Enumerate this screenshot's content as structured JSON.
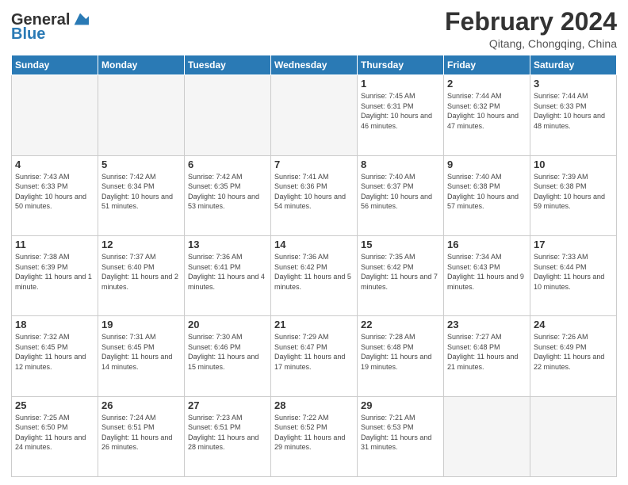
{
  "header": {
    "logo_line1": "General",
    "logo_line2": "Blue",
    "title": "February 2024",
    "subtitle": "Qitang, Chongqing, China"
  },
  "days_of_week": [
    "Sunday",
    "Monday",
    "Tuesday",
    "Wednesday",
    "Thursday",
    "Friday",
    "Saturday"
  ],
  "weeks": [
    [
      {
        "day": "",
        "info": ""
      },
      {
        "day": "",
        "info": ""
      },
      {
        "day": "",
        "info": ""
      },
      {
        "day": "",
        "info": ""
      },
      {
        "day": "1",
        "info": "Sunrise: 7:45 AM\nSunset: 6:31 PM\nDaylight: 10 hours\nand 46 minutes."
      },
      {
        "day": "2",
        "info": "Sunrise: 7:44 AM\nSunset: 6:32 PM\nDaylight: 10 hours\nand 47 minutes."
      },
      {
        "day": "3",
        "info": "Sunrise: 7:44 AM\nSunset: 6:33 PM\nDaylight: 10 hours\nand 48 minutes."
      }
    ],
    [
      {
        "day": "4",
        "info": "Sunrise: 7:43 AM\nSunset: 6:33 PM\nDaylight: 10 hours\nand 50 minutes."
      },
      {
        "day": "5",
        "info": "Sunrise: 7:42 AM\nSunset: 6:34 PM\nDaylight: 10 hours\nand 51 minutes."
      },
      {
        "day": "6",
        "info": "Sunrise: 7:42 AM\nSunset: 6:35 PM\nDaylight: 10 hours\nand 53 minutes."
      },
      {
        "day": "7",
        "info": "Sunrise: 7:41 AM\nSunset: 6:36 PM\nDaylight: 10 hours\nand 54 minutes."
      },
      {
        "day": "8",
        "info": "Sunrise: 7:40 AM\nSunset: 6:37 PM\nDaylight: 10 hours\nand 56 minutes."
      },
      {
        "day": "9",
        "info": "Sunrise: 7:40 AM\nSunset: 6:38 PM\nDaylight: 10 hours\nand 57 minutes."
      },
      {
        "day": "10",
        "info": "Sunrise: 7:39 AM\nSunset: 6:38 PM\nDaylight: 10 hours\nand 59 minutes."
      }
    ],
    [
      {
        "day": "11",
        "info": "Sunrise: 7:38 AM\nSunset: 6:39 PM\nDaylight: 11 hours\nand 1 minute."
      },
      {
        "day": "12",
        "info": "Sunrise: 7:37 AM\nSunset: 6:40 PM\nDaylight: 11 hours\nand 2 minutes."
      },
      {
        "day": "13",
        "info": "Sunrise: 7:36 AM\nSunset: 6:41 PM\nDaylight: 11 hours\nand 4 minutes."
      },
      {
        "day": "14",
        "info": "Sunrise: 7:36 AM\nSunset: 6:42 PM\nDaylight: 11 hours\nand 5 minutes."
      },
      {
        "day": "15",
        "info": "Sunrise: 7:35 AM\nSunset: 6:42 PM\nDaylight: 11 hours\nand 7 minutes."
      },
      {
        "day": "16",
        "info": "Sunrise: 7:34 AM\nSunset: 6:43 PM\nDaylight: 11 hours\nand 9 minutes."
      },
      {
        "day": "17",
        "info": "Sunrise: 7:33 AM\nSunset: 6:44 PM\nDaylight: 11 hours\nand 10 minutes."
      }
    ],
    [
      {
        "day": "18",
        "info": "Sunrise: 7:32 AM\nSunset: 6:45 PM\nDaylight: 11 hours\nand 12 minutes."
      },
      {
        "day": "19",
        "info": "Sunrise: 7:31 AM\nSunset: 6:45 PM\nDaylight: 11 hours\nand 14 minutes."
      },
      {
        "day": "20",
        "info": "Sunrise: 7:30 AM\nSunset: 6:46 PM\nDaylight: 11 hours\nand 15 minutes."
      },
      {
        "day": "21",
        "info": "Sunrise: 7:29 AM\nSunset: 6:47 PM\nDaylight: 11 hours\nand 17 minutes."
      },
      {
        "day": "22",
        "info": "Sunrise: 7:28 AM\nSunset: 6:48 PM\nDaylight: 11 hours\nand 19 minutes."
      },
      {
        "day": "23",
        "info": "Sunrise: 7:27 AM\nSunset: 6:48 PM\nDaylight: 11 hours\nand 21 minutes."
      },
      {
        "day": "24",
        "info": "Sunrise: 7:26 AM\nSunset: 6:49 PM\nDaylight: 11 hours\nand 22 minutes."
      }
    ],
    [
      {
        "day": "25",
        "info": "Sunrise: 7:25 AM\nSunset: 6:50 PM\nDaylight: 11 hours\nand 24 minutes."
      },
      {
        "day": "26",
        "info": "Sunrise: 7:24 AM\nSunset: 6:51 PM\nDaylight: 11 hours\nand 26 minutes."
      },
      {
        "day": "27",
        "info": "Sunrise: 7:23 AM\nSunset: 6:51 PM\nDaylight: 11 hours\nand 28 minutes."
      },
      {
        "day": "28",
        "info": "Sunrise: 7:22 AM\nSunset: 6:52 PM\nDaylight: 11 hours\nand 29 minutes."
      },
      {
        "day": "29",
        "info": "Sunrise: 7:21 AM\nSunset: 6:53 PM\nDaylight: 11 hours\nand 31 minutes."
      },
      {
        "day": "",
        "info": ""
      },
      {
        "day": "",
        "info": ""
      }
    ]
  ]
}
